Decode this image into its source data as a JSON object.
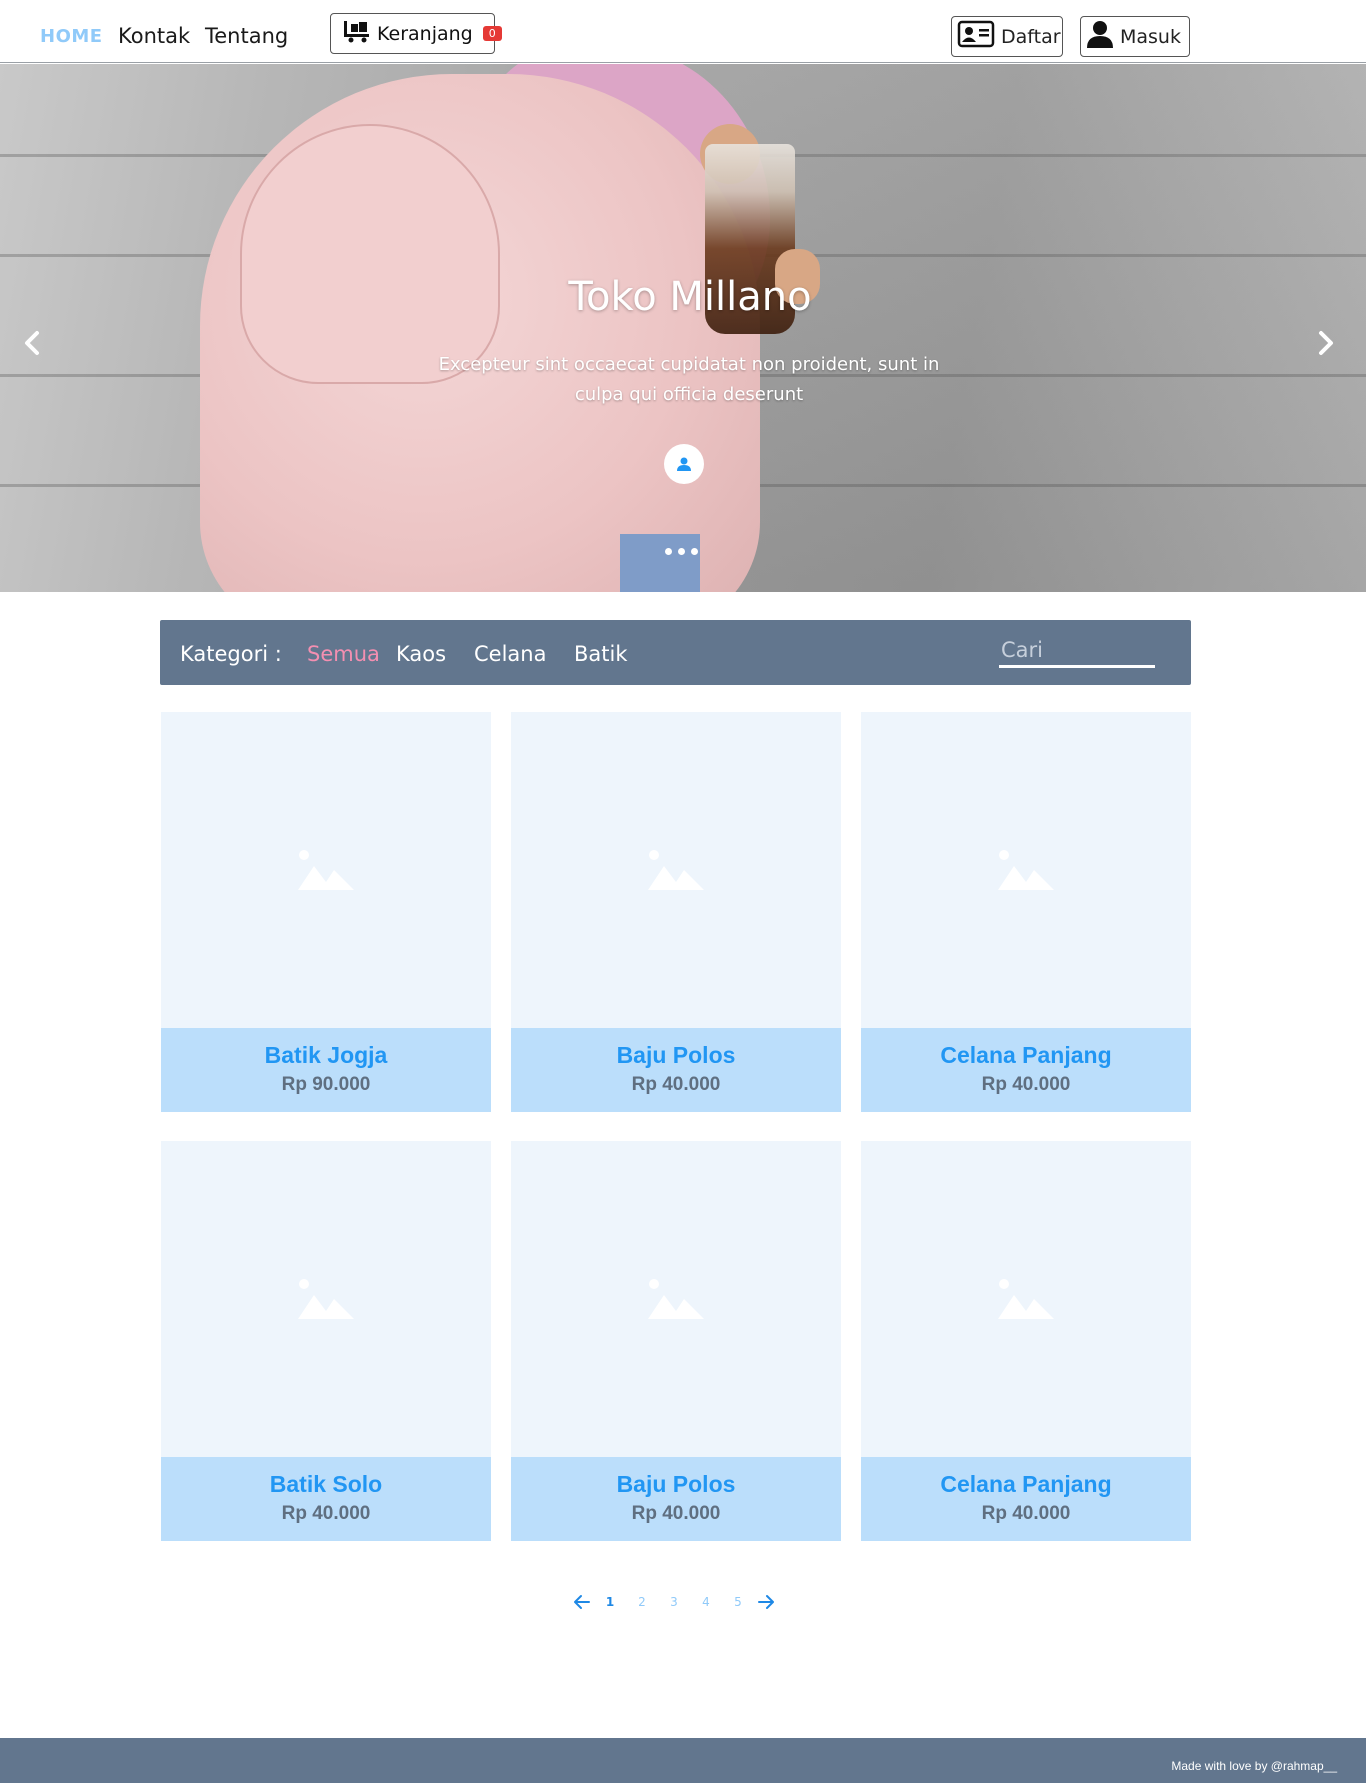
{
  "nav": {
    "home": "HOME",
    "kontak": "Kontak",
    "tentang": "Tentang",
    "cart_label": "Keranjang",
    "cart_count": "0",
    "register_label": "Daftar",
    "login_label": "Masuk"
  },
  "hero": {
    "title": "Toko Millano",
    "subtitle": "Excepteur sint occaecat cupidatat non proident, sunt in culpa qui officia deserunt",
    "slide_count": 3
  },
  "categories": {
    "label": "Kategori :",
    "items": [
      "Semua",
      "Kaos",
      "Celana",
      "Batik"
    ],
    "active": "Semua",
    "search_placeholder": "Cari"
  },
  "products": [
    {
      "name": "Batik Jogja",
      "price": "Rp 90.000"
    },
    {
      "name": "Baju Polos",
      "price": "Rp 40.000"
    },
    {
      "name": "Celana Panjang",
      "price": "Rp 40.000"
    },
    {
      "name": "Batik Solo",
      "price": "Rp 40.000"
    },
    {
      "name": "Baju Polos",
      "price": "Rp 40.000"
    },
    {
      "name": "Celana Panjang",
      "price": "Rp 40.000"
    }
  ],
  "pagination": {
    "pages": [
      "1",
      "2",
      "3",
      "4",
      "5"
    ],
    "current": "1"
  },
  "footer": {
    "text": "Made with love by @rahmap__"
  },
  "colors": {
    "accent": "#2196f3",
    "nav_active": "#90caf9",
    "category_bar": "#62768e",
    "category_active": "#f48fb1",
    "card_info": "#bbdefb",
    "cart_badge": "#e53935"
  }
}
